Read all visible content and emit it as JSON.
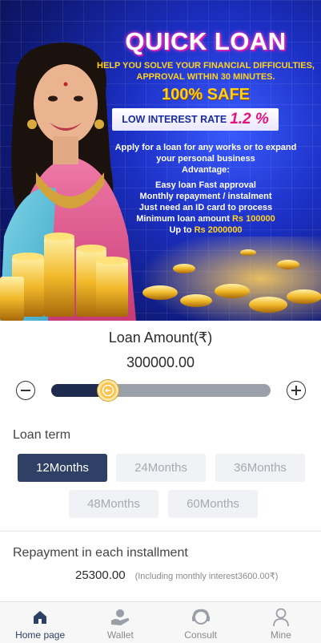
{
  "banner": {
    "title": "QUICK LOAN",
    "subtitle_line1": "HELP YOU SOLVE YOUR FINANCIAL DIFFICULTIES,",
    "subtitle_line2": "APPROVAL WITHIN 30 MINUTES.",
    "safe": "100% SAFE",
    "rate_label": "LOW INTEREST RATE",
    "rate_value": "1.2 %",
    "body_line1": "Apply for a loan for any works or to expand",
    "body_line2": "your personal business",
    "body_line3": "Advantage:",
    "adv_line1": "Easy loan Fast approval",
    "adv_line2": "Monthly repayment / instalment",
    "adv_line3": "Just need an ID card to process",
    "adv_line4_prefix": "Minimum loan amount ",
    "adv_line4_value": "Rs 100000",
    "adv_line5_prefix": "Up to ",
    "adv_line5_value": "Rs 2000000"
  },
  "loan": {
    "amount_label": "Loan Amount(₹)",
    "amount_value": "300000.00",
    "slider_fraction": 0.26
  },
  "term": {
    "label": "Loan term",
    "options": [
      {
        "label": "12Months",
        "active": true
      },
      {
        "label": "24Months",
        "active": false
      },
      {
        "label": "36Months",
        "active": false
      },
      {
        "label": "48Months",
        "active": false
      },
      {
        "label": "60Months",
        "active": false
      }
    ]
  },
  "repayment": {
    "label": "Repayment in each installment",
    "value": "25300.00",
    "note": "(Including monthly interest3600.00₹)"
  },
  "nav": {
    "items": [
      {
        "label": "Home page",
        "icon": "home-icon",
        "active": true
      },
      {
        "label": "Wallet",
        "icon": "wallet-icon",
        "active": false
      },
      {
        "label": "Consult",
        "icon": "consult-icon",
        "active": false
      },
      {
        "label": "Mine",
        "icon": "user-icon",
        "active": false
      }
    ]
  },
  "colors": {
    "accent": "#2e4066",
    "slider_track": "#9aa0a9",
    "slider_fill": "#1e2a4e",
    "thumb": "#fbc34a"
  }
}
